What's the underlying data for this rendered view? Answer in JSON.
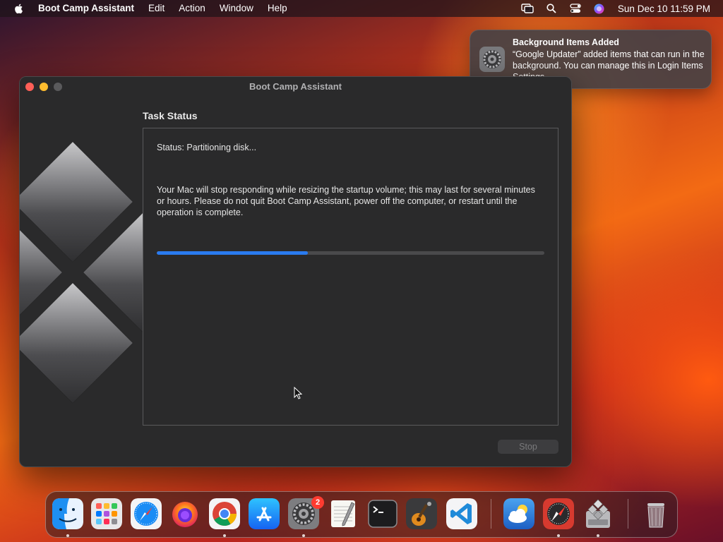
{
  "menubar": {
    "app_name": "Boot Camp Assistant",
    "items": [
      "Edit",
      "Action",
      "Window",
      "Help"
    ],
    "clock": "Sun Dec 10  11:59 PM",
    "tray_icons": [
      "screen-mirroring-icon",
      "spotlight-search-icon",
      "control-center-icon",
      "siri-icon"
    ]
  },
  "window": {
    "title": "Boot Camp Assistant",
    "section_title": "Task Status",
    "status": "Status: Partitioning disk...",
    "warning": "Your Mac will stop responding while resizing the startup volume; this may last for several minutes or hours. Please do not quit Boot Camp Assistant, power off the computer, or restart until the operation is complete.",
    "progress": 0.39,
    "stop_label": "Stop"
  },
  "notification": {
    "title": "Background Items Added",
    "body": "“Google Updater” added items that can run in the background. You can manage this in Login Items Settings.",
    "icon": "system-settings-icon"
  },
  "dock": {
    "apps": [
      {
        "name": "Finder",
        "icon": "finder-icon",
        "running": true
      },
      {
        "name": "Launchpad",
        "icon": "launchpad-icon",
        "running": false
      },
      {
        "name": "Safari",
        "icon": "safari-icon",
        "running": false
      },
      {
        "name": "Firefox",
        "icon": "firefox-icon",
        "running": false
      },
      {
        "name": "Google Chrome",
        "icon": "chrome-icon",
        "running": true
      },
      {
        "name": "App Store",
        "icon": "app-store-icon",
        "running": false
      },
      {
        "name": "System Settings",
        "icon": "system-settings-icon",
        "running": true,
        "badge": "2"
      },
      {
        "name": "TextEdit",
        "icon": "textedit-icon",
        "running": false
      },
      {
        "name": "Terminal",
        "icon": "terminal-icon",
        "running": false
      },
      {
        "name": "GarageBand",
        "icon": "garageband-icon",
        "running": false
      },
      {
        "name": "Visual Studio Code",
        "icon": "vscode-icon",
        "running": false
      },
      {
        "name": "Weather",
        "icon": "weather-icon",
        "running": false
      },
      {
        "name": "Safari Technology Preview",
        "icon": "compass-app-icon",
        "running": true
      },
      {
        "name": "Boot Camp Assistant",
        "icon": "boot-camp-icon",
        "running": true
      },
      {
        "name": "Trash",
        "icon": "trash-icon",
        "running": false
      }
    ]
  },
  "colors": {
    "accent": "#2a7bf0",
    "close": "#ff5f57",
    "minimize": "#febc2e",
    "badge": "#ff3b30"
  }
}
